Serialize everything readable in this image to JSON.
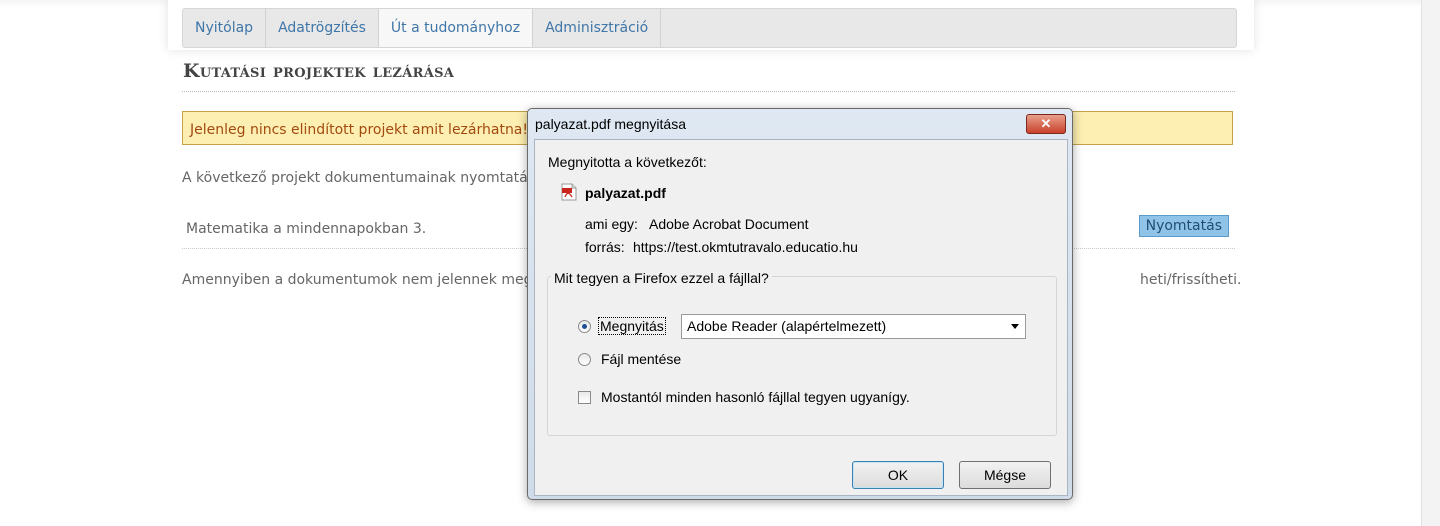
{
  "nav": {
    "tabs": [
      {
        "label": "Nyitólap"
      },
      {
        "label": "Adatrögzítés"
      },
      {
        "label": "Út a tudományhoz"
      },
      {
        "label": "Adminisztráció"
      }
    ],
    "active_index": 2
  },
  "page": {
    "title": "Kutatási projektek lezárása",
    "warning": "Jelenleg nincs elindított projekt amit lezárhatna!",
    "intro": "A következő projekt dokumentumainak nyomtatás",
    "project_name": "Matematika a mindennapokban 3.",
    "print_button": "Nyomtatás",
    "note_left": "Amennyiben a dokumentumok nem jelennek meg",
    "note_right": "heti/frissítheti."
  },
  "dialog": {
    "title": "palyazat.pdf megnyitása",
    "close_label": "✕",
    "prompt": "Megnyitotta a következőt:",
    "filename": "palyazat.pdf",
    "type_label": "ami egy:",
    "type_value": "Adobe Acrobat Document",
    "source_label": "forrás:",
    "source_value": "https://test.okmtutravalo.educatio.hu",
    "group_legend": "Mit tegyen a Firefox ezzel a fájllal?",
    "open_label": "Megnyitás",
    "open_with_value": "Adobe Reader  (alapértelmezett)",
    "save_label": "Fájl mentése",
    "remember_label": "Mostantól minden hasonló fájllal tegyen ugyanígy.",
    "ok_label": "OK",
    "cancel_label": "Mégse",
    "selected_option": "open",
    "remember_checked": false
  },
  "colors": {
    "nav_link": "#3f76a8",
    "warning_bg": "#fdefb1",
    "warning_text": "#a24a10",
    "print_button_bg": "#8fc3e8"
  }
}
